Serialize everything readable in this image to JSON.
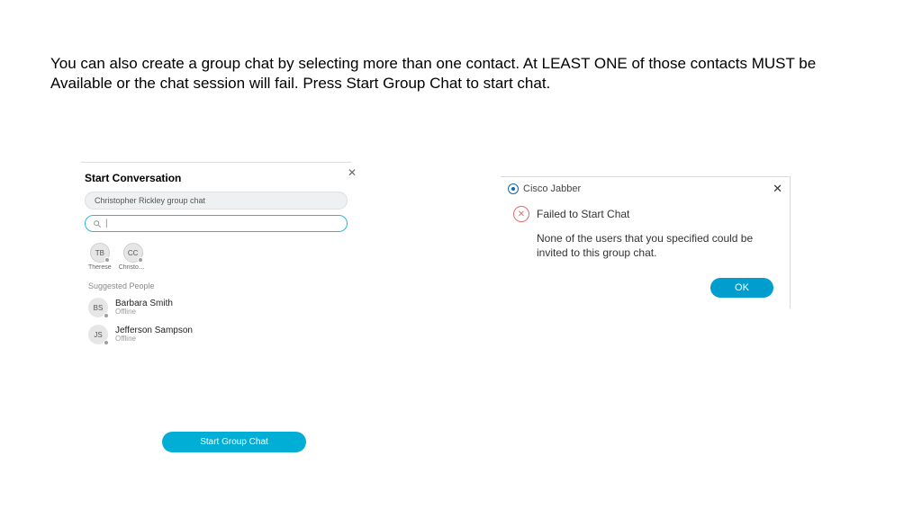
{
  "instruction_text": "You can also create a group chat by selecting more than one contact.  At LEAST ONE of those contacts MUST be Available or the chat session will fail.  Press Start Group Chat to start chat.",
  "left": {
    "title": "Start Conversation",
    "chat_name": "Christopher Rickley group chat",
    "search_placeholder": "",
    "search_value": "|",
    "chips": [
      {
        "initials": "TB",
        "label": "Therese"
      },
      {
        "initials": "CC",
        "label": "Christoph..."
      }
    ],
    "suggested_label": "Suggested People",
    "people": [
      {
        "initials": "BS",
        "name": "Barbara Smith",
        "status": "Offline"
      },
      {
        "initials": "JS",
        "name": "Jefferson Sampson",
        "status": "Offline"
      }
    ],
    "start_button": "Start Group Chat"
  },
  "right": {
    "app_name": "Cisco Jabber",
    "error_title": "Failed to Start Chat",
    "error_message": "None of the users that you specified could be invited to this group chat.",
    "ok": "OK"
  }
}
